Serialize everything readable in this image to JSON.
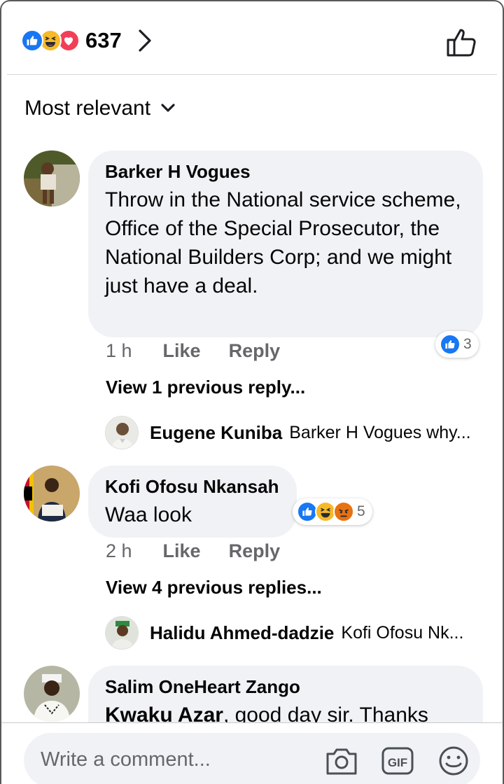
{
  "header": {
    "reaction_count": "637",
    "reaction_icons": [
      "like-reaction",
      "haha-reaction",
      "love-reaction"
    ]
  },
  "sort": {
    "label": "Most relevant"
  },
  "comments": [
    {
      "author": "Barker H Vogues",
      "text": "Throw in the National service scheme, Office of the Special Prosecutor, the National Builders Corp; and we might just have a deal.",
      "time": "1 h",
      "like_label": "Like",
      "reply_label": "Reply",
      "reaction_count": "3",
      "view_more": "View 1 previous reply...",
      "latest_reply": {
        "author": "Eugene Kuniba",
        "text": "Barker H Vogues why..."
      }
    },
    {
      "author": "Kofi Ofosu Nkansah",
      "text": "Waa look",
      "time": "2 h",
      "like_label": "Like",
      "reply_label": "Reply",
      "reaction_count": "5",
      "view_more": "View 4 previous replies...",
      "latest_reply": {
        "author": "Halidu Ahmed-dadzie",
        "text": "Kofi Ofosu Nk..."
      }
    },
    {
      "author": "Salim OneHeart Zango",
      "mention": "Kwaku Azar",
      "text": ", good day sir. Thanks"
    }
  ],
  "composer": {
    "placeholder": "Write a comment..."
  },
  "colors": {
    "like_blue": "#1877f2",
    "haha_yellow": "#f7b928",
    "love_red": "#f33e58",
    "angry_orange": "#e9710f",
    "bubble_bg": "#f0f2f5",
    "meta_gray": "#65676b"
  }
}
